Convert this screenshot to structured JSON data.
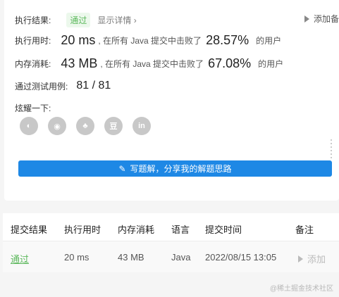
{
  "result": {
    "label": "执行结果:",
    "status": "通过",
    "details_link": "显示详情 ›",
    "add_note": "添加备"
  },
  "runtime": {
    "label": "执行用时:",
    "value": "20 ms",
    "prefix": ", 在所有 Java 提交中击败了",
    "percent": "28.57%",
    "suffix": "的用户"
  },
  "memory": {
    "label": "内存消耗:",
    "value": "43 MB",
    "prefix": ", 在所有 Java 提交中击败了",
    "percent": "67.08%",
    "suffix": "的用户"
  },
  "tests": {
    "label": "通过测试用例:",
    "value": "81 / 81"
  },
  "share_section": {
    "label": "炫耀一下:",
    "icons": [
      "wechat-icon",
      "weibo-icon",
      "qq-icon",
      "douban-icon",
      "linkedin-icon"
    ],
    "icon_glyphs": [
      "◐",
      "◉",
      "♣",
      "豆",
      "in"
    ],
    "button_label": "写题解，分享我的解题思路"
  },
  "submissions_table": {
    "headers": [
      "提交结果",
      "执行用时",
      "内存消耗",
      "语言",
      "提交时间",
      "备注"
    ],
    "rows": [
      {
        "result": "通过",
        "runtime": "20 ms",
        "memory": "43 MB",
        "language": "Java",
        "time": "2022/08/15 13:05",
        "note": "添加"
      }
    ]
  },
  "watermark": "@稀土掘金技术社区",
  "colors": {
    "accent": "#1e88e5",
    "success": "#5cb85c"
  }
}
